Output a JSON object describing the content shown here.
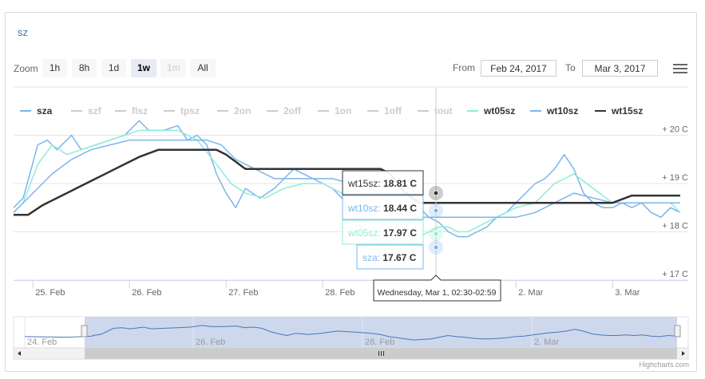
{
  "title": "sz",
  "rangeSelector": {
    "zoom_label": "Zoom",
    "buttons": [
      {
        "label": "1h",
        "state": "normal"
      },
      {
        "label": "8h",
        "state": "normal"
      },
      {
        "label": "1d",
        "state": "normal"
      },
      {
        "label": "1w",
        "state": "active"
      },
      {
        "label": "1m",
        "state": "disabled"
      },
      {
        "label": "All",
        "state": "normal"
      }
    ],
    "from_label": "From",
    "from_value": "Feb 24, 2017",
    "to_label": "To",
    "to_value": "Mar 3, 2017"
  },
  "credits": "Highcharts.com",
  "tooltip": {
    "header": "Wednesday, Mar 1, 02:30-02:59",
    "rows": [
      {
        "series": "wt15sz",
        "value": "18.81 C",
        "color": "#333333"
      },
      {
        "series": "wt10sz",
        "value": "18.44 C",
        "color": "#7cb5ec"
      },
      {
        "series": "wt05sz",
        "value": "17.97 C",
        "color": "#90ecd6"
      },
      {
        "series": "sza",
        "value": "17.67 C",
        "color": "#7cb5ec"
      }
    ]
  },
  "chart_data": {
    "type": "line",
    "x_ticks": [
      "25. Feb",
      "26. Feb",
      "27. Feb",
      "28. Feb",
      "1. Mar",
      "2. Mar",
      "3. Mar"
    ],
    "y_ticks": [
      "+ 17 C",
      "+ 18 C",
      "+ 19 C",
      "+ 20 C"
    ],
    "ylim": [
      17,
      20.2
    ],
    "xlim": [
      24.8,
      31.7
    ],
    "grid": true,
    "legend_position": "top",
    "legend": [
      {
        "name": "sza",
        "visible": true,
        "color": "#7cb5ec"
      },
      {
        "name": "szf",
        "visible": false,
        "color": "#cccccc"
      },
      {
        "name": "flsz",
        "visible": false,
        "color": "#cccccc"
      },
      {
        "name": "tpsz",
        "visible": false,
        "color": "#cccccc"
      },
      {
        "name": "2on",
        "visible": false,
        "color": "#cccccc"
      },
      {
        "name": "2off",
        "visible": false,
        "color": "#cccccc"
      },
      {
        "name": "1on",
        "visible": false,
        "color": "#cccccc"
      },
      {
        "name": "1off",
        "visible": false,
        "color": "#cccccc"
      },
      {
        "name": "tout",
        "visible": false,
        "color": "#cccccc"
      },
      {
        "name": "wt05sz",
        "visible": true,
        "color": "#90ecd6"
      },
      {
        "name": "wt10sz",
        "visible": true,
        "color": "#7cb5ec"
      },
      {
        "name": "wt15sz",
        "visible": true,
        "color": "#333333"
      }
    ],
    "series": [
      {
        "name": "sza",
        "color": "#7cb5ec",
        "width": 1.5,
        "x": [
          24.8,
          24.9,
          25.05,
          25.15,
          25.25,
          25.4,
          25.5,
          25.65,
          25.8,
          25.95,
          26.1,
          26.2,
          26.35,
          26.5,
          26.6,
          26.7,
          26.8,
          26.9,
          27.0,
          27.1,
          27.2,
          27.35,
          27.5,
          27.6,
          27.7,
          27.8,
          27.9,
          28.0,
          28.1,
          28.2,
          28.3,
          28.4,
          28.5,
          28.6,
          28.7,
          28.8,
          28.9,
          29.0,
          29.1,
          29.2,
          29.3,
          29.4,
          29.5,
          29.6,
          29.7,
          29.8,
          29.9,
          30.0,
          30.1,
          30.2,
          30.3,
          30.4,
          30.5,
          30.6,
          30.7,
          30.8,
          30.9,
          31.0,
          31.1,
          31.2,
          31.3,
          31.4,
          31.5,
          31.6,
          31.7
        ],
        "y": [
          18.5,
          18.7,
          19.8,
          19.9,
          19.7,
          20.0,
          19.7,
          19.8,
          19.9,
          20.0,
          20.3,
          20.1,
          20.1,
          20.2,
          19.9,
          20.0,
          19.8,
          19.2,
          18.8,
          18.5,
          18.9,
          18.7,
          18.9,
          19.1,
          19.3,
          19.2,
          19.1,
          19.0,
          18.9,
          18.7,
          18.3,
          18.1,
          17.9,
          17.7,
          17.8,
          17.9,
          18.2,
          18.5,
          18.3,
          18.2,
          18.0,
          17.9,
          17.9,
          18.0,
          18.1,
          18.3,
          18.4,
          18.6,
          18.8,
          19.0,
          19.1,
          19.3,
          19.6,
          19.3,
          18.8,
          18.6,
          18.5,
          18.5,
          18.6,
          18.5,
          18.6,
          18.4,
          18.3,
          18.5,
          18.4
        ]
      },
      {
        "name": "wt05sz",
        "color": "#90ecd6",
        "width": 1.5,
        "x": [
          24.8,
          24.9,
          25.05,
          25.2,
          25.35,
          25.5,
          25.65,
          25.8,
          25.95,
          26.1,
          26.3,
          26.5,
          26.7,
          26.9,
          27.05,
          27.2,
          27.4,
          27.6,
          27.8,
          28.0,
          28.2,
          28.4,
          28.6,
          28.8,
          28.9,
          29.0,
          29.1,
          29.2,
          29.3,
          29.4,
          29.5,
          29.6,
          29.7,
          29.8,
          30.0,
          30.2,
          30.4,
          30.6,
          30.8,
          31.0,
          31.2,
          31.4,
          31.6,
          31.7
        ],
        "y": [
          18.4,
          18.6,
          19.4,
          19.8,
          19.6,
          19.7,
          19.8,
          19.9,
          20.0,
          20.1,
          20.1,
          20.1,
          19.9,
          19.4,
          19.0,
          18.8,
          18.7,
          18.9,
          19.0,
          19.0,
          18.8,
          18.5,
          18.2,
          17.9,
          17.8,
          17.9,
          18.0,
          18.1,
          18.1,
          18.0,
          18.0,
          18.1,
          18.2,
          18.3,
          18.5,
          18.6,
          19.0,
          19.2,
          18.9,
          18.6,
          18.6,
          18.6,
          18.6,
          18.4
        ]
      },
      {
        "name": "wt10sz",
        "color": "#7cb5ec",
        "width": 1.5,
        "x": [
          24.8,
          25.0,
          25.2,
          25.4,
          25.6,
          25.8,
          26.0,
          26.2,
          26.4,
          26.6,
          26.8,
          26.95,
          27.1,
          27.3,
          27.5,
          27.7,
          27.9,
          28.1,
          28.3,
          28.5,
          28.7,
          28.85,
          29.0,
          29.2,
          29.4,
          29.6,
          29.8,
          30.0,
          30.2,
          30.4,
          30.6,
          30.8,
          31.0,
          31.2,
          31.4,
          31.7
        ],
        "y": [
          18.4,
          18.8,
          19.2,
          19.5,
          19.7,
          19.8,
          19.9,
          19.9,
          19.9,
          19.9,
          19.9,
          19.8,
          19.5,
          19.3,
          19.1,
          19.1,
          19.1,
          19.1,
          19.0,
          18.9,
          18.6,
          18.44,
          18.3,
          18.3,
          18.3,
          18.3,
          18.3,
          18.3,
          18.4,
          18.6,
          18.8,
          18.7,
          18.6,
          18.6,
          18.6,
          18.6
        ]
      },
      {
        "name": "wt15sz",
        "color": "#333333",
        "width": 2.5,
        "x": [
          24.8,
          24.95,
          25.1,
          25.3,
          25.5,
          25.7,
          25.9,
          26.1,
          26.3,
          26.5,
          26.7,
          26.9,
          27.0,
          27.2,
          27.4,
          27.6,
          27.8,
          28.0,
          28.2,
          28.4,
          28.6,
          28.7,
          28.85,
          29.0,
          29.2,
          29.4,
          29.6,
          29.8,
          30.0,
          30.2,
          30.4,
          30.6,
          30.8,
          31.0,
          31.2,
          31.4,
          31.7
        ],
        "y": [
          18.35,
          18.35,
          18.55,
          18.75,
          18.95,
          19.15,
          19.35,
          19.55,
          19.7,
          19.7,
          19.7,
          19.7,
          19.6,
          19.3,
          19.3,
          19.3,
          19.3,
          19.3,
          19.3,
          19.3,
          19.3,
          19.2,
          18.81,
          18.6,
          18.6,
          18.6,
          18.6,
          18.6,
          18.6,
          18.6,
          18.6,
          18.6,
          18.6,
          18.6,
          18.75,
          18.75,
          18.75
        ]
      }
    ],
    "navigator": {
      "x_ticks": [
        "24. Feb",
        "26. Feb",
        "28. Feb",
        "2. Mar"
      ],
      "series_name": "sza"
    }
  }
}
